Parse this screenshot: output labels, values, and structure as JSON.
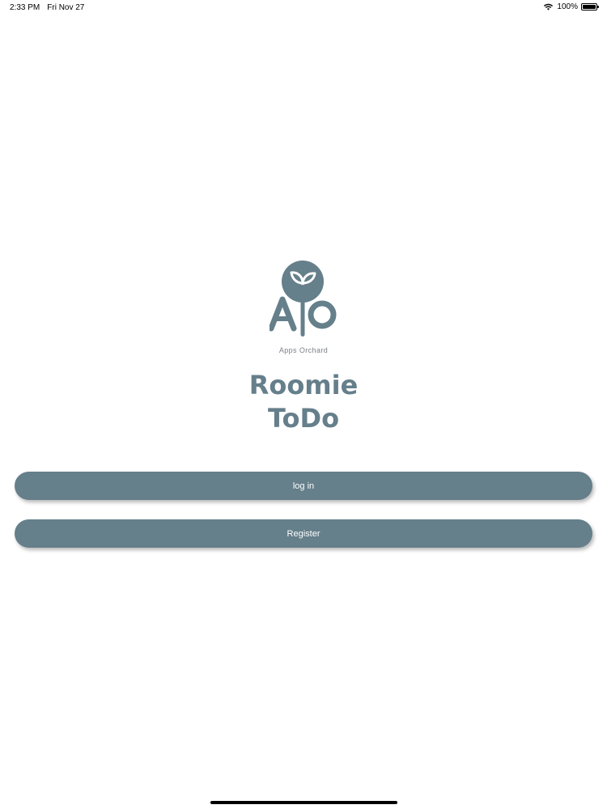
{
  "status_bar": {
    "time": "2:33 PM",
    "date": "Fri Nov 27",
    "battery": "100%",
    "battery_level": 1.0,
    "icons": [
      "wifi-icon",
      "battery-icon"
    ]
  },
  "logo": {
    "company_name": "Apps Orchard",
    "icon": "apps-orchard-logo-icon",
    "color": "#657f8b"
  },
  "app": {
    "title_line1": "Roomie",
    "title_line2": "ToDo"
  },
  "buttons": {
    "login_label": "log in",
    "register_label": "Register"
  },
  "colors": {
    "accent": "#657f8b",
    "background": "#ffffff",
    "button_text": "#ffffff"
  }
}
